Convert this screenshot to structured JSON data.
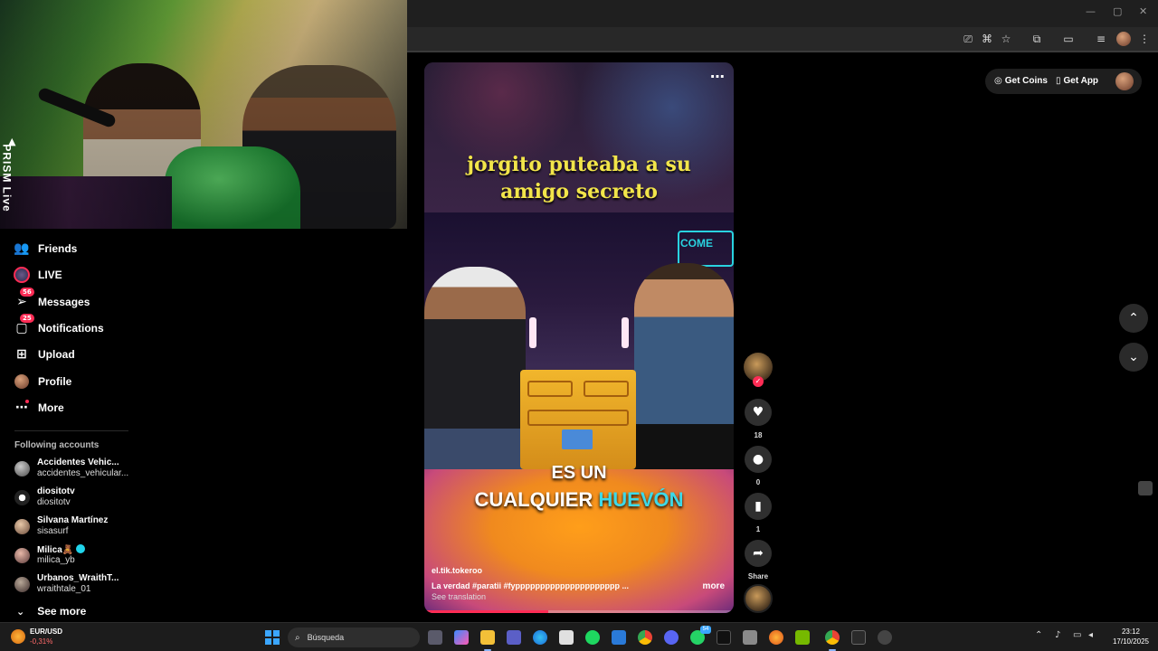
{
  "sidebar": {
    "nav": [
      {
        "label": "Friends",
        "icon": "friends-icon"
      },
      {
        "label": "LIVE",
        "icon": "live-icon"
      },
      {
        "label": "Messages",
        "icon": "messages-icon",
        "badge": "56"
      },
      {
        "label": "Notifications",
        "icon": "notifications-icon",
        "badge": "25"
      },
      {
        "label": "Upload",
        "icon": "upload-icon"
      },
      {
        "label": "Profile",
        "icon": "profile-icon"
      },
      {
        "label": "More",
        "icon": "more-icon"
      }
    ],
    "following_title": "Following accounts",
    "accounts": [
      {
        "name": "Accidentes Vehic...",
        "user": "accidentes_vehicular..."
      },
      {
        "name": "diositotv",
        "user": "diositotv"
      },
      {
        "name": "Silvana Martínez",
        "user": "sisasurf"
      },
      {
        "name": "Milica🧸",
        "user": "milica_yb",
        "verified": true
      },
      {
        "name": "Urbanos_WraithT...",
        "user": "wraithtale_01"
      }
    ],
    "see_more": "See more"
  },
  "webcam": {
    "overlay": "PRISM Live"
  },
  "video": {
    "title_line1": "jorgito puteaba a su",
    "title_line2": "amigo secreto",
    "scene_sign": "COME",
    "caption_line1": "ES UN",
    "caption_word1": "CUALQUIER",
    "caption_word2": "HUEVÓN",
    "author": "el.tik.tokeroo",
    "description": "La verdad #paratii  #fyppppppppppppppppppppp  ...",
    "more": "more",
    "see_translation": "See translation",
    "progress": 0.4
  },
  "actions": {
    "likes": "18",
    "comments": "0",
    "saves": "1",
    "share": "Share"
  },
  "topbar": {
    "get_coins": "Get Coins",
    "get_app": "Get App"
  },
  "taskbar": {
    "ticker": "EUR/USD",
    "change": "-0,31%",
    "search_placeholder": "Búsqueda",
    "whatsapp_badge": "54",
    "time": "23:12",
    "date": "17/10/2025"
  },
  "colors": {
    "accent": "#fe2c55",
    "caption_highlight": "#3dd9e8",
    "title_yellow": "#f2e54a"
  }
}
